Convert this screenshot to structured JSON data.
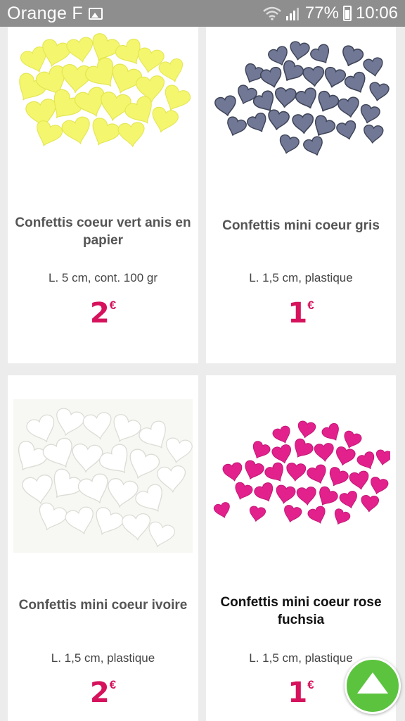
{
  "status_bar": {
    "carrier": "Orange F",
    "battery": "77%",
    "time": "10:06"
  },
  "products": [
    {
      "name": "Confettis coeur vert anis en papier",
      "desc": "L. 5 cm, cont. 100 gr",
      "price": "2",
      "currency": "€",
      "image_icon": "yellow-heart-confetti",
      "color": "#f3f56a"
    },
    {
      "name": "Confettis mini coeur gris",
      "desc": "L. 1,5 cm, plastique",
      "price": "1",
      "currency": "€",
      "image_icon": "grey-heart-confetti",
      "color": "#6f7690"
    },
    {
      "name": "Confettis mini coeur ivoire",
      "desc": "L. 1,5 cm, plastique",
      "price": "2",
      "currency": "€",
      "image_icon": "ivory-heart-confetti",
      "color": "#f4f4f0"
    },
    {
      "name": "Confettis mini coeur rose fuchsia",
      "desc": "L. 1,5 cm, plastique",
      "price": "1",
      "currency": "€",
      "image_icon": "fuchsia-heart-confetti",
      "color": "#e0208a"
    }
  ],
  "colors": {
    "price": "#d6125d",
    "scroll_button": "#5cc33f",
    "status_bar": "#8e8e8e"
  }
}
